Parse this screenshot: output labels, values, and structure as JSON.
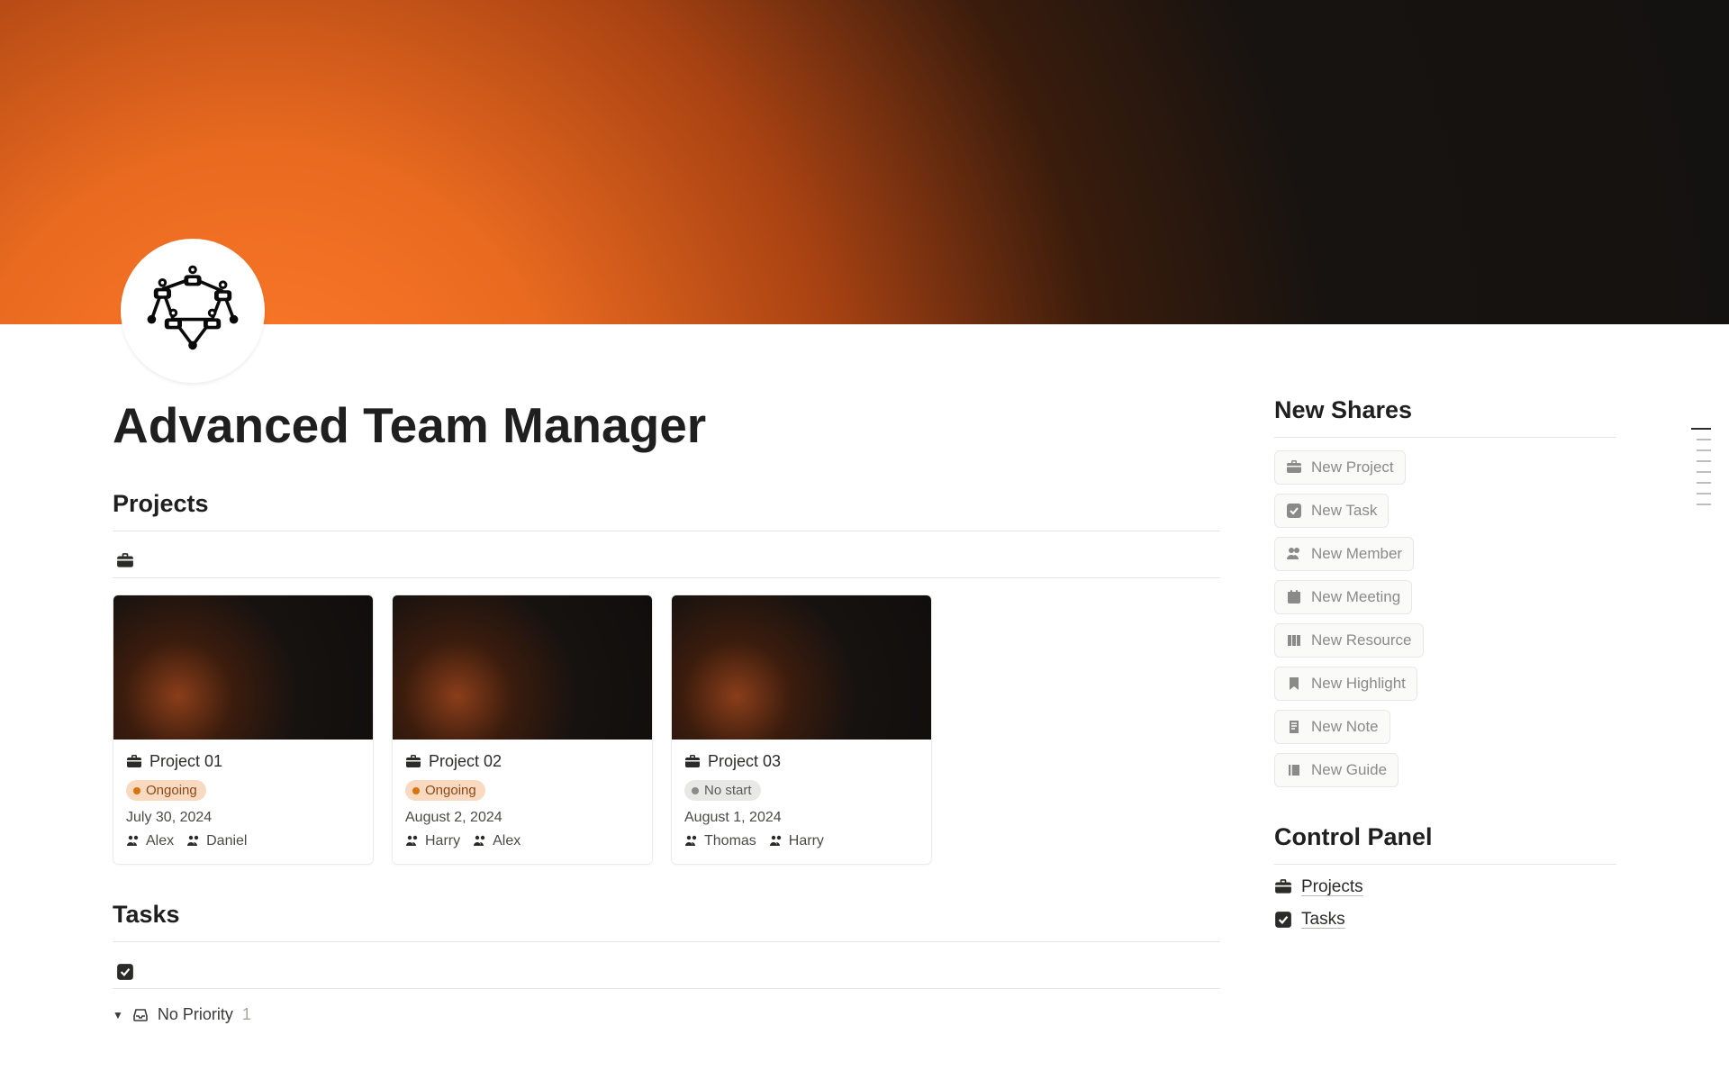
{
  "page": {
    "title": "Advanced Team Manager"
  },
  "projects": {
    "heading": "Projects",
    "cards": [
      {
        "title": "Project 01",
        "status_label": "Ongoing",
        "status_kind": "ongoing",
        "date": "July 30, 2024",
        "members": [
          "Alex",
          "Daniel"
        ]
      },
      {
        "title": "Project 02",
        "status_label": "Ongoing",
        "status_kind": "ongoing",
        "date": "August 2, 2024",
        "members": [
          "Harry",
          "Alex"
        ]
      },
      {
        "title": "Project 03",
        "status_label": "No start",
        "status_kind": "nostart",
        "date": "August 1, 2024",
        "members": [
          "Thomas",
          "Harry"
        ]
      }
    ]
  },
  "tasks": {
    "heading": "Tasks",
    "group_label": "No Priority",
    "group_count": "1"
  },
  "new_shares": {
    "heading": "New Shares",
    "buttons": [
      {
        "icon": "briefcase",
        "label": "New Project"
      },
      {
        "icon": "check",
        "label": "New Task"
      },
      {
        "icon": "members",
        "label": "New Member"
      },
      {
        "icon": "calendar",
        "label": "New Meeting"
      },
      {
        "icon": "resource",
        "label": "New Resource"
      },
      {
        "icon": "bookmark",
        "label": "New Highlight"
      },
      {
        "icon": "note",
        "label": "New Note"
      },
      {
        "icon": "guide",
        "label": "New Guide"
      }
    ]
  },
  "control_panel": {
    "heading": "Control Panel",
    "items": [
      {
        "icon": "briefcase",
        "label": "Projects"
      },
      {
        "icon": "check",
        "label": "Tasks"
      }
    ]
  },
  "outline_lines": [
    22,
    16,
    16,
    16,
    16,
    16,
    16,
    16
  ]
}
